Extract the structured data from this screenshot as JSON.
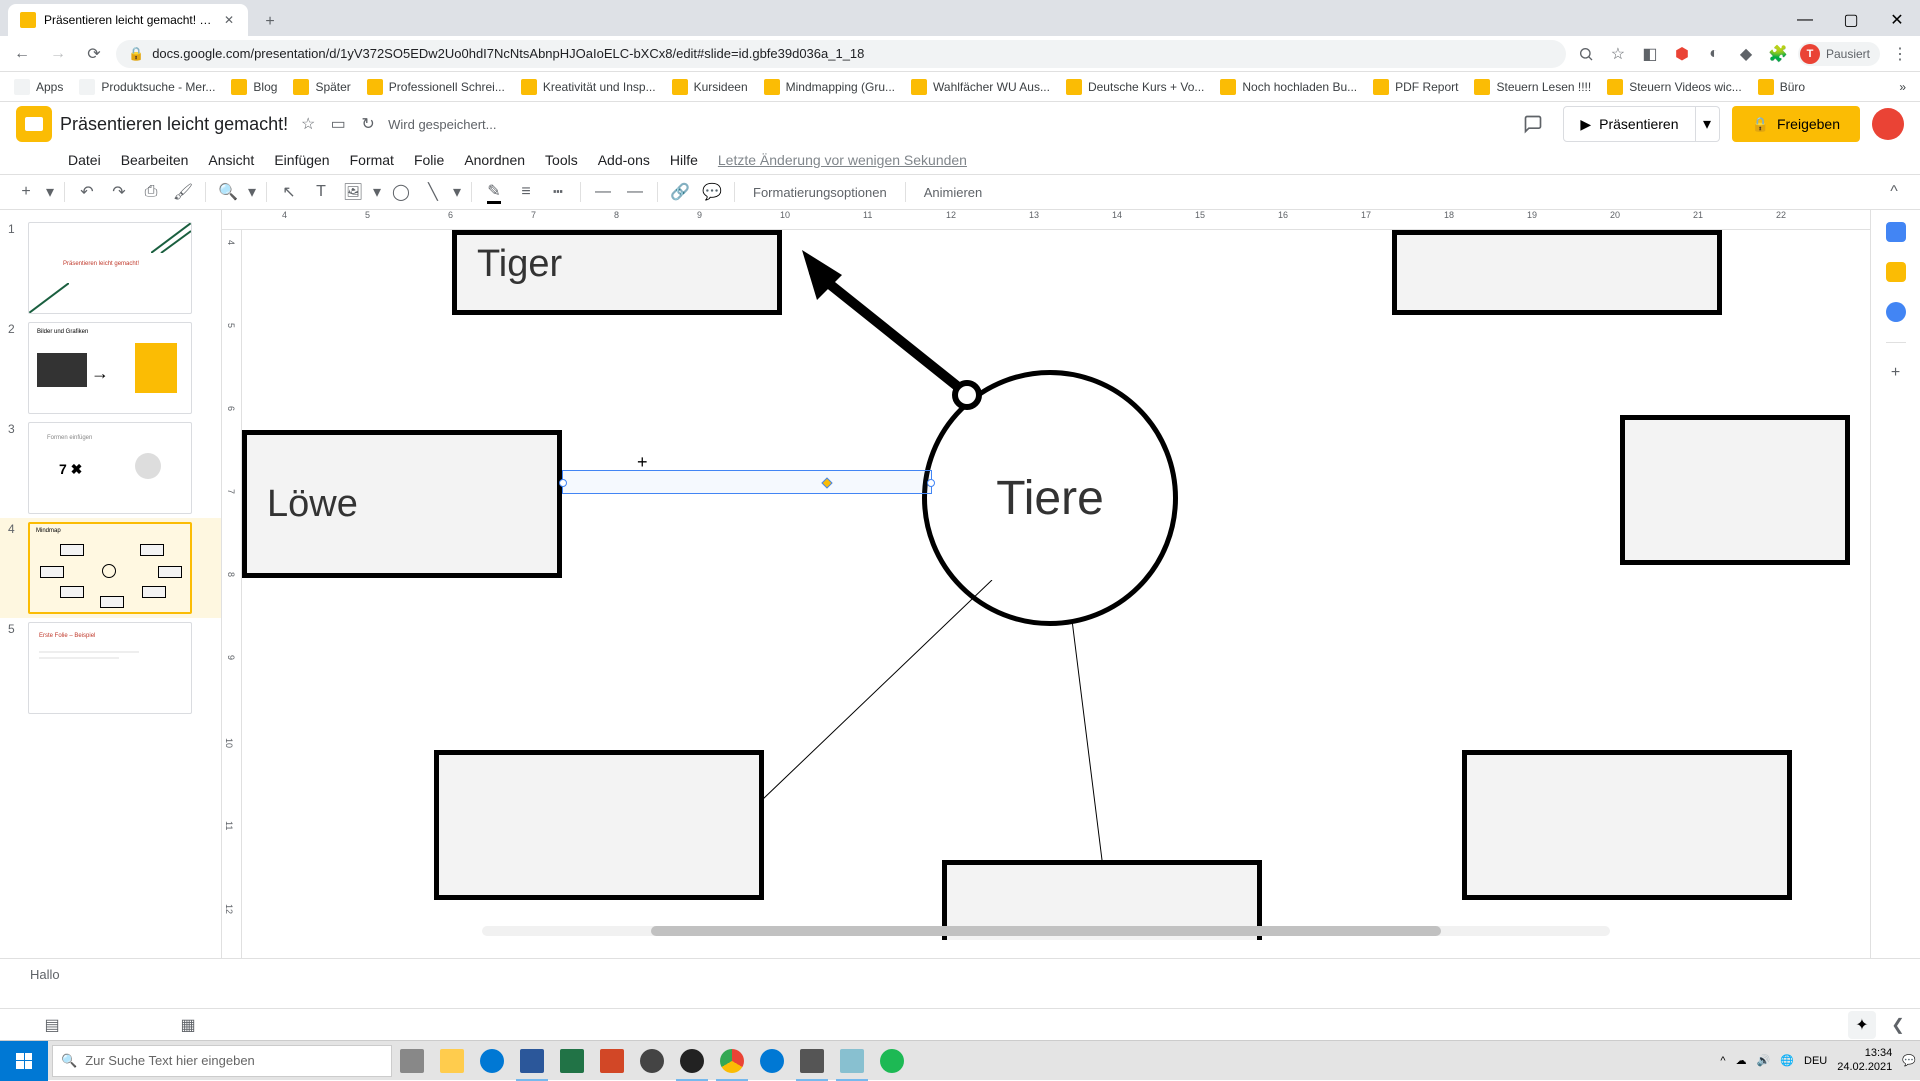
{
  "browser": {
    "tab_title": "Präsentieren leicht gemacht! - G",
    "url": "docs.google.com/presentation/d/1yV372SO5EDw2Uo0hdI7NcNtsAbnpHJOaIoELC-bXCx8/edit#slide=id.gbfe39d036a_1_18",
    "paused": "Pausiert",
    "bookmarks": [
      "Apps",
      "Produktsuche - Mer...",
      "Blog",
      "Später",
      "Professionell Schrei...",
      "Kreativität und Insp...",
      "Kursideen",
      "Mindmapping  (Gru...",
      "Wahlfächer WU Aus...",
      "Deutsche Kurs + Vo...",
      "Noch hochladen Bu...",
      "PDF Report",
      "Steuern Lesen !!!!",
      "Steuern Videos wic...",
      "Büro"
    ]
  },
  "doc": {
    "title": "Präsentieren leicht gemacht!",
    "save_status": "Wird gespeichert...",
    "last_change": "Letzte Änderung vor wenigen Sekunden",
    "present": "Präsentieren",
    "share": "Freigeben"
  },
  "menus": [
    "Datei",
    "Bearbeiten",
    "Ansicht",
    "Einfügen",
    "Format",
    "Folie",
    "Anordnen",
    "Tools",
    "Add-ons",
    "Hilfe"
  ],
  "toolbar": {
    "format_options": "Formatierungsoptionen",
    "animate": "Animieren"
  },
  "ruler_h": [
    "4",
    "5",
    "6",
    "7",
    "8",
    "9",
    "10",
    "11",
    "12",
    "13",
    "14",
    "15",
    "16",
    "17",
    "18",
    "19",
    "20",
    "21",
    "22"
  ],
  "ruler_v": [
    "4",
    "5",
    "6",
    "7",
    "8",
    "9",
    "10",
    "11",
    "12"
  ],
  "slides": {
    "thumb1": "Präsentieren leicht gemacht!",
    "thumb2": "Bilder und Grafiken",
    "thumb3a": "Formen einfügen",
    "thumb3b": "7 ✖",
    "thumb4": "Mindmap",
    "thumb5": "Erste Folie – Beispiel"
  },
  "canvas": {
    "tiger": "Tiger",
    "loewe": "Löwe",
    "tiere": "Tiere"
  },
  "notes": "Hallo",
  "taskbar": {
    "search_placeholder": "Zur Suche Text hier eingeben",
    "lang": "DEU",
    "time": "13:34",
    "date": "24.02.2021"
  }
}
